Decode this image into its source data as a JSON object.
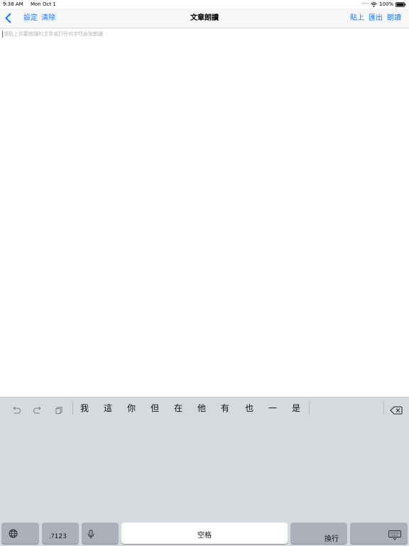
{
  "status_bar": {
    "time": "9:38 AM",
    "date": "Mon Oct 1",
    "battery_percent": "100%",
    "wifi_icon": "wifi-icon",
    "battery_icon": "battery-icon"
  },
  "nav": {
    "back_icon": "chevron-left-icon",
    "settings": "設定",
    "clear": "清除",
    "title": "文章朗讀",
    "paste": "貼上",
    "export": "匯出",
    "read_aloud": "朗讀",
    "accent_color": "#1a7cf5"
  },
  "editor": {
    "value": "",
    "placeholder": "請貼上你要朗讀的文章或打任何字然後按朗讀"
  },
  "keyboard": {
    "tools": [
      "undo-icon",
      "redo-icon",
      "paste-icon"
    ],
    "candidates": [
      "我",
      "這",
      "你",
      "但",
      "在",
      "他",
      "有",
      "也",
      "一",
      "是"
    ],
    "delete_icon": "delete-backward-icon",
    "globe_icon": "globe-icon",
    "numbers_key": ".?123",
    "mic_icon": "microphone-icon",
    "space_key": "空格",
    "return_key": "換行",
    "dismiss_icon": "keyboard-dismiss-icon",
    "background_color": "#d6d9de"
  }
}
